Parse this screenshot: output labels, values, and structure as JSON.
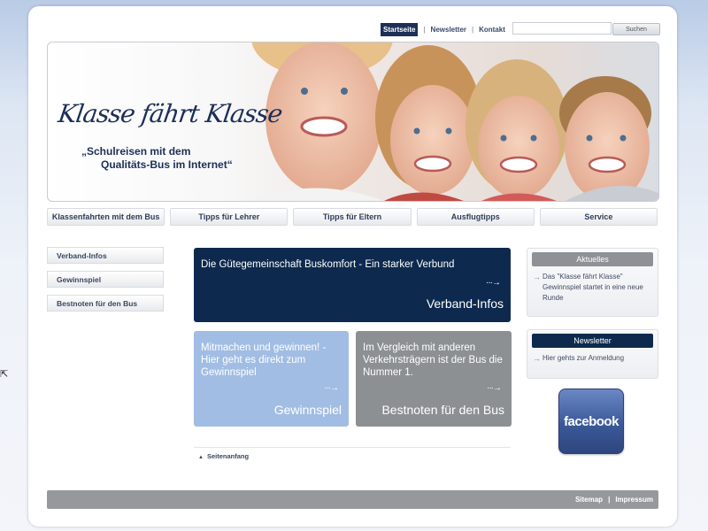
{
  "topnav": {
    "home": "Startseite",
    "newsletter": "Newsletter",
    "contact": "Kontakt",
    "sep": "|"
  },
  "search": {
    "placeholder": "",
    "button": "Suchen"
  },
  "banner": {
    "title": "Klasse fährt Klasse",
    "tagline_1": "„Schulreisen mit dem",
    "tagline_2": "Qualitäts-Bus im Internet“"
  },
  "mainnav": [
    "Klassenfahrten mit dem Bus",
    "Tipps für Lehrer",
    "Tipps für Eltern",
    "Ausflugtipps",
    "Service"
  ],
  "leftnav": [
    "Verband-Infos",
    "Gewinnspiel",
    "Bestnoten für den Bus"
  ],
  "tiles": {
    "verband": {
      "text": "Die Gütegemeinschaft Buskomfort - Ein starker Verbund",
      "label": "Verband-Infos"
    },
    "gewinnspiel": {
      "text": "Mitmachen und gewinnen! - Hier geht es direkt zum Gewinnspiel",
      "label": "Gewinnspiel"
    },
    "bestnoten": {
      "text": "Im Vergleich mit anderen Verkehrsträgern ist der Bus die Nummer 1.",
      "label": "Bestnoten für den Bus"
    },
    "arrow": "···→"
  },
  "back_to_top": "Seitenanfang",
  "aktuelles": {
    "title": "Aktuelles",
    "text": "Das \"Klasse fährt Klasse\" Gewinnspiel startet in eine neue Runde"
  },
  "newsletter_box": {
    "title": "Newsletter",
    "text": "Hier gehts zur Anmeldung"
  },
  "facebook": "facebook",
  "footer": {
    "sitemap": "Sitemap",
    "impressum": "Impressum",
    "sep": "|"
  },
  "colors": {
    "navy": "#0d2a4e",
    "light_blue": "#a2bde3",
    "gray": "#8c9093",
    "footer": "#96999c"
  }
}
